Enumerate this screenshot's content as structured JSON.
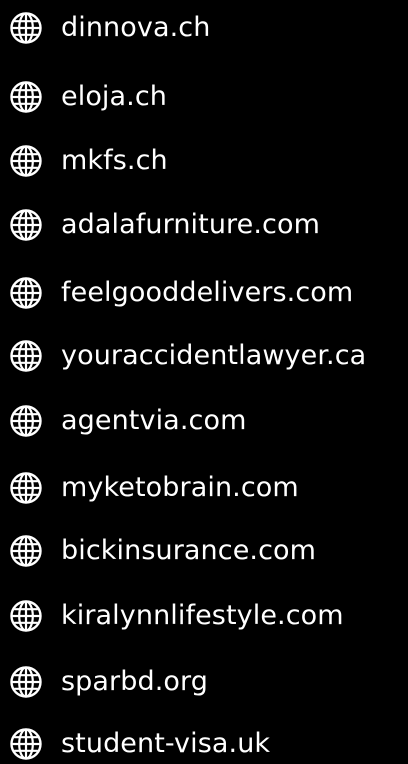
{
  "domains": [
    {
      "label": "dinnova.ch",
      "icon": "globe-icon"
    },
    {
      "label": "eloja.ch",
      "icon": "globe-icon"
    },
    {
      "label": "mkfs.ch",
      "icon": "globe-icon"
    },
    {
      "label": "adalafurniture.com",
      "icon": "globe-icon"
    },
    {
      "label": "feelgooddelivers.com",
      "icon": "globe-icon"
    },
    {
      "label": "youraccidentlawyer.ca",
      "icon": "globe-icon"
    },
    {
      "label": "agentvia.com",
      "icon": "globe-icon"
    },
    {
      "label": "myketobrain.com",
      "icon": "globe-icon"
    },
    {
      "label": "bickinsurance.com",
      "icon": "globe-icon"
    },
    {
      "label": "kiralynnlifestyle.com",
      "icon": "globe-icon"
    },
    {
      "label": "sparbd.org",
      "icon": "globe-icon"
    },
    {
      "label": "student-visa.uk",
      "icon": "globe-icon"
    }
  ],
  "colors": {
    "background": "#000000",
    "foreground": "#ffffff"
  }
}
